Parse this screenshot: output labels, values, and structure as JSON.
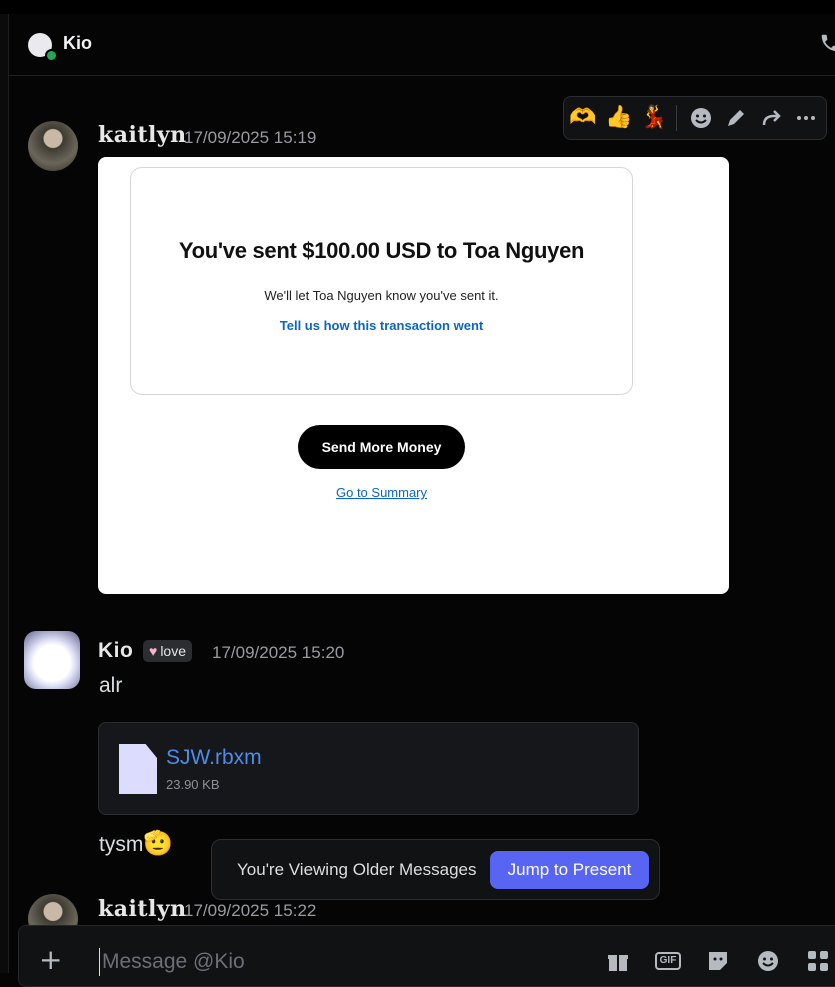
{
  "header": {
    "dm_name": "Kio"
  },
  "toolbar": {
    "reactions": [
      "🫶",
      "👍",
      "💃"
    ],
    "icons": [
      "smile-icon",
      "pencil-icon",
      "reply-icon",
      "more-icon"
    ]
  },
  "messages": {
    "m1": {
      "author": "kaitlyn",
      "timestamp": "17/09/2025 15:19"
    },
    "m2": {
      "author": "Kio",
      "badge": "love",
      "timestamp": "17/09/2025 15:20",
      "text1": "alr",
      "text2": "tysm",
      "text2_emoji": "🫡"
    },
    "m3": {
      "author": "kaitlyn",
      "timestamp": "17/09/2025 15:22"
    }
  },
  "payment": {
    "title": "You've sent $100.00 USD to Toa Nguyen",
    "subtitle": "We'll let Toa Nguyen know you've sent it.",
    "feedback_link": "Tell us how this transaction went",
    "send_button": "Send More Money",
    "summary_link": "Go to Summary"
  },
  "attachment": {
    "filename": "SJW.rbxm",
    "size": "23.90 KB"
  },
  "older_banner": {
    "text": "You're Viewing Older Messages",
    "button": "Jump to Present"
  },
  "composer": {
    "placeholder": "Message @Kio"
  }
}
